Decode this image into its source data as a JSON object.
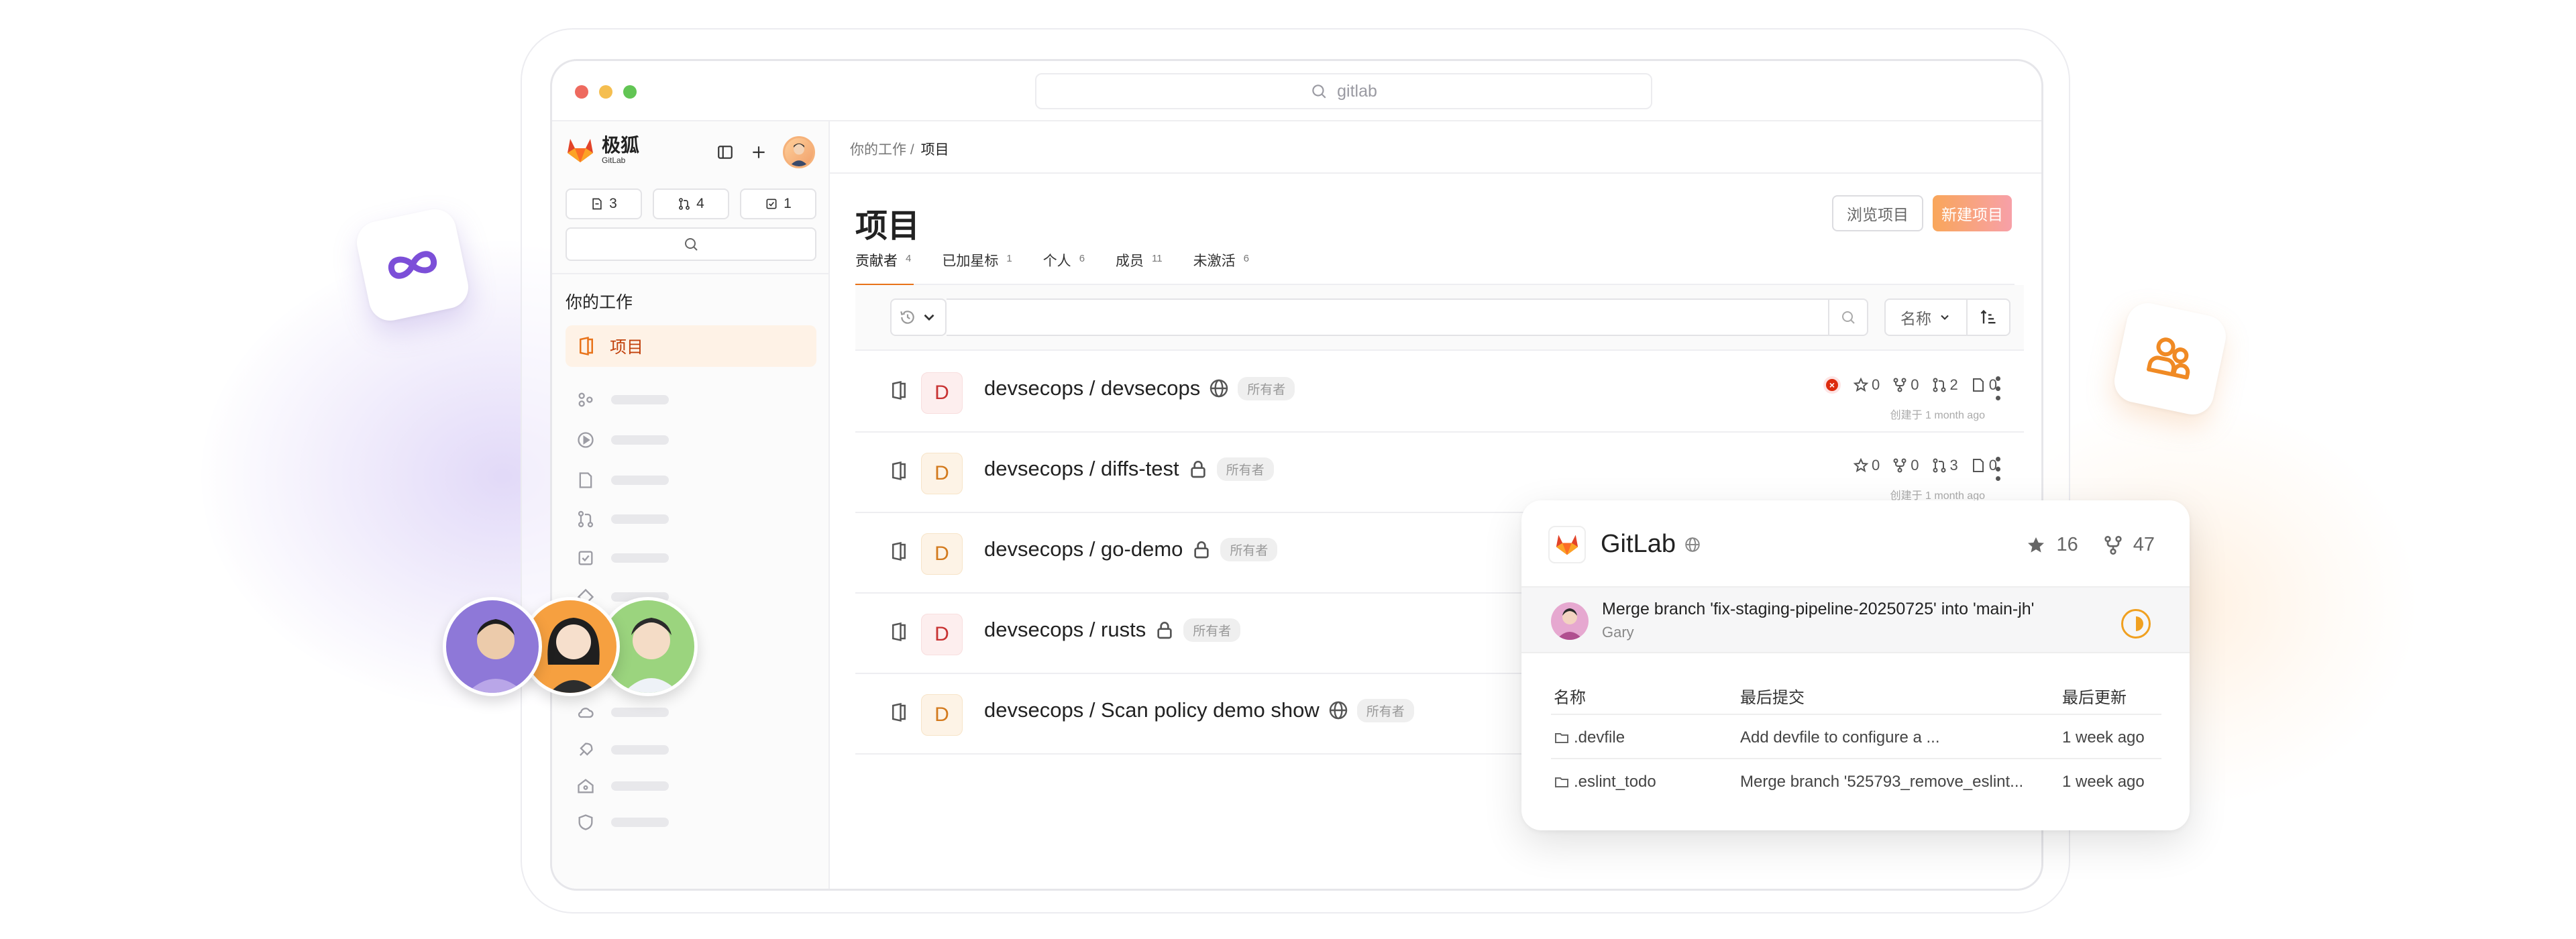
{
  "window": {
    "url": "gitlab"
  },
  "sidebar": {
    "brand_cn": "极狐",
    "brand_en": "GitLab",
    "counters": [
      {
        "icon": "issues-icon",
        "value": "3"
      },
      {
        "icon": "merge-request-icon",
        "value": "4"
      },
      {
        "icon": "todo-icon",
        "value": "1"
      }
    ],
    "section_heading": "你的工作",
    "active_item": "项目"
  },
  "main": {
    "breadcrumb_parent": "你的工作 /",
    "breadcrumb_current": "项目",
    "title": "项目",
    "browse_button": "浏览项目",
    "new_button": "新建项目",
    "tabs": [
      {
        "label": "贡献者",
        "count": "4"
      },
      {
        "label": "已加星标",
        "count": "1"
      },
      {
        "label": "个人",
        "count": "6"
      },
      {
        "label": "成员",
        "count": "11"
      },
      {
        "label": "未激活",
        "count": "6"
      }
    ],
    "sort_label": "名称",
    "projects": [
      {
        "letter": "D",
        "name": "devsecops / devsecops",
        "visibility": "public",
        "role": "所有者",
        "stars": "0",
        "forks": "0",
        "mrs": "2",
        "issues": "0",
        "created": "创建于 1 month ago",
        "pipeline_failed": true
      },
      {
        "letter": "D",
        "name": "devsecops / diffs-test",
        "visibility": "private",
        "role": "所有者",
        "stars": "0",
        "forks": "0",
        "mrs": "3",
        "issues": "0",
        "created": "创建于 1 month ago"
      },
      {
        "letter": "D",
        "name": "devsecops / go-demo",
        "visibility": "private",
        "role": "所有者"
      },
      {
        "letter": "D",
        "name": "devsecops / rusts",
        "visibility": "private",
        "role": "所有者"
      },
      {
        "letter": "D",
        "name": "devsecops / Scan policy demo show",
        "visibility": "public",
        "role": "所有者"
      }
    ]
  },
  "popup": {
    "title": "GitLab",
    "stars": "16",
    "forks": "47",
    "commit_message": "Merge branch 'fix-staging-pipeline-20250725' into 'main-jh'",
    "commit_author": "Gary",
    "table_headers": [
      "名称",
      "最后提交",
      "最后更新"
    ],
    "rows": [
      {
        "name": ".devfile",
        "commit": "Add devfile to configure a ...",
        "updated": "1 week ago"
      },
      {
        "name": ".eslint_todo",
        "commit": "Merge branch '525793_remove_eslint...",
        "updated": "1 week ago"
      }
    ]
  },
  "colors": {
    "accent": "#e8731a",
    "danger": "#dd2b0e",
    "brand_gradient_start": "#f9a65a",
    "brand_gradient_end": "#f7a0a8"
  }
}
